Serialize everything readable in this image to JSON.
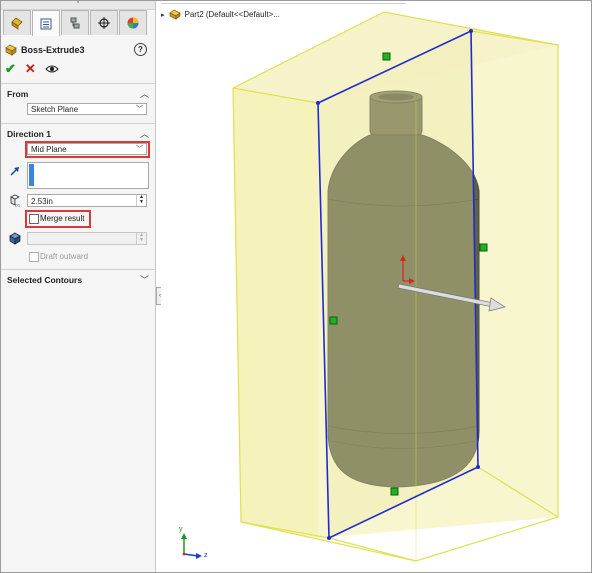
{
  "feature": {
    "title": "Boss-Extrude3",
    "help_glyph": "?"
  },
  "from": {
    "heading": "From",
    "value": "Sketch Plane"
  },
  "direction1": {
    "heading": "Direction 1",
    "end_condition": "Mid Plane",
    "depth": "2.53in",
    "merge_label": "Merge result",
    "draft_label": "Draft outward"
  },
  "contours": {
    "heading": "Selected Contours"
  },
  "tree": {
    "part_label": "Part2  (Default<<Default>..."
  },
  "axes": {
    "y": "y",
    "z": "z"
  },
  "colors": {
    "accent_red": "#d83a3a",
    "selection_blue": "#3b88d8",
    "preview_yellow": "#f2eda6",
    "edge_blue": "#1f2bd0",
    "bottle": "#5f6148"
  }
}
